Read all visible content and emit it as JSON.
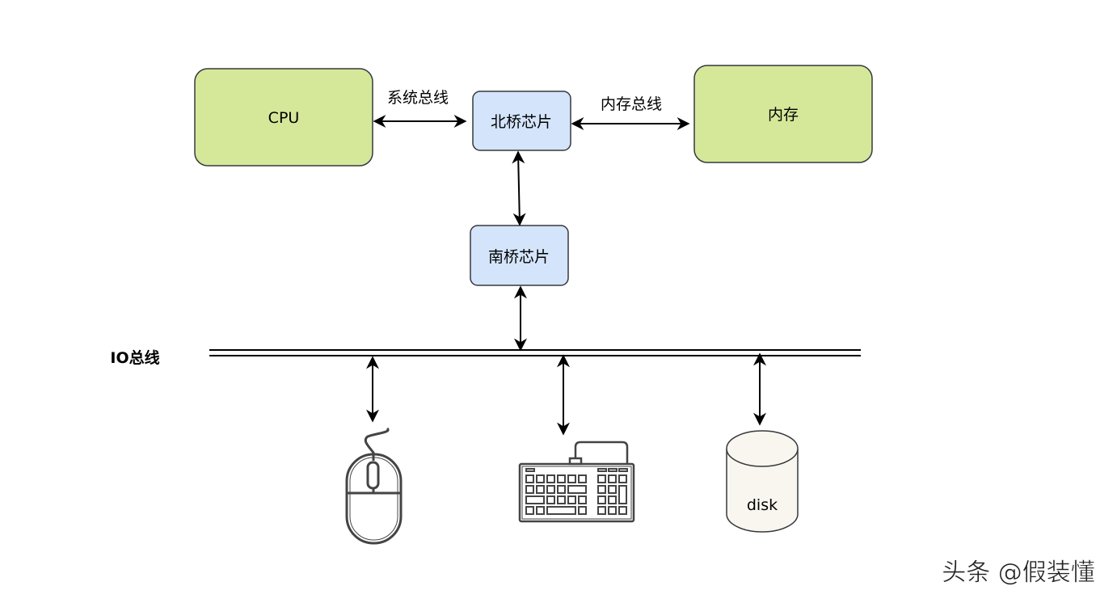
{
  "nodes": {
    "cpu": "CPU",
    "northbridge": "北桥芯片",
    "memory": "内存",
    "southbridge": "南桥芯片",
    "disk": "disk"
  },
  "edges": {
    "system_bus": "系统总线",
    "memory_bus": "内存总线",
    "io_bus": "IO总线"
  },
  "devices": [
    "mouse-icon",
    "keyboard-icon",
    "disk-icon"
  ],
  "colors": {
    "cpu_memory_fill": "#d5e89a",
    "chip_fill": "#d4e4fb",
    "disk_fill": "#f8f6ee",
    "stroke": "#36393d"
  },
  "watermark": "头条 @假装懂编程"
}
